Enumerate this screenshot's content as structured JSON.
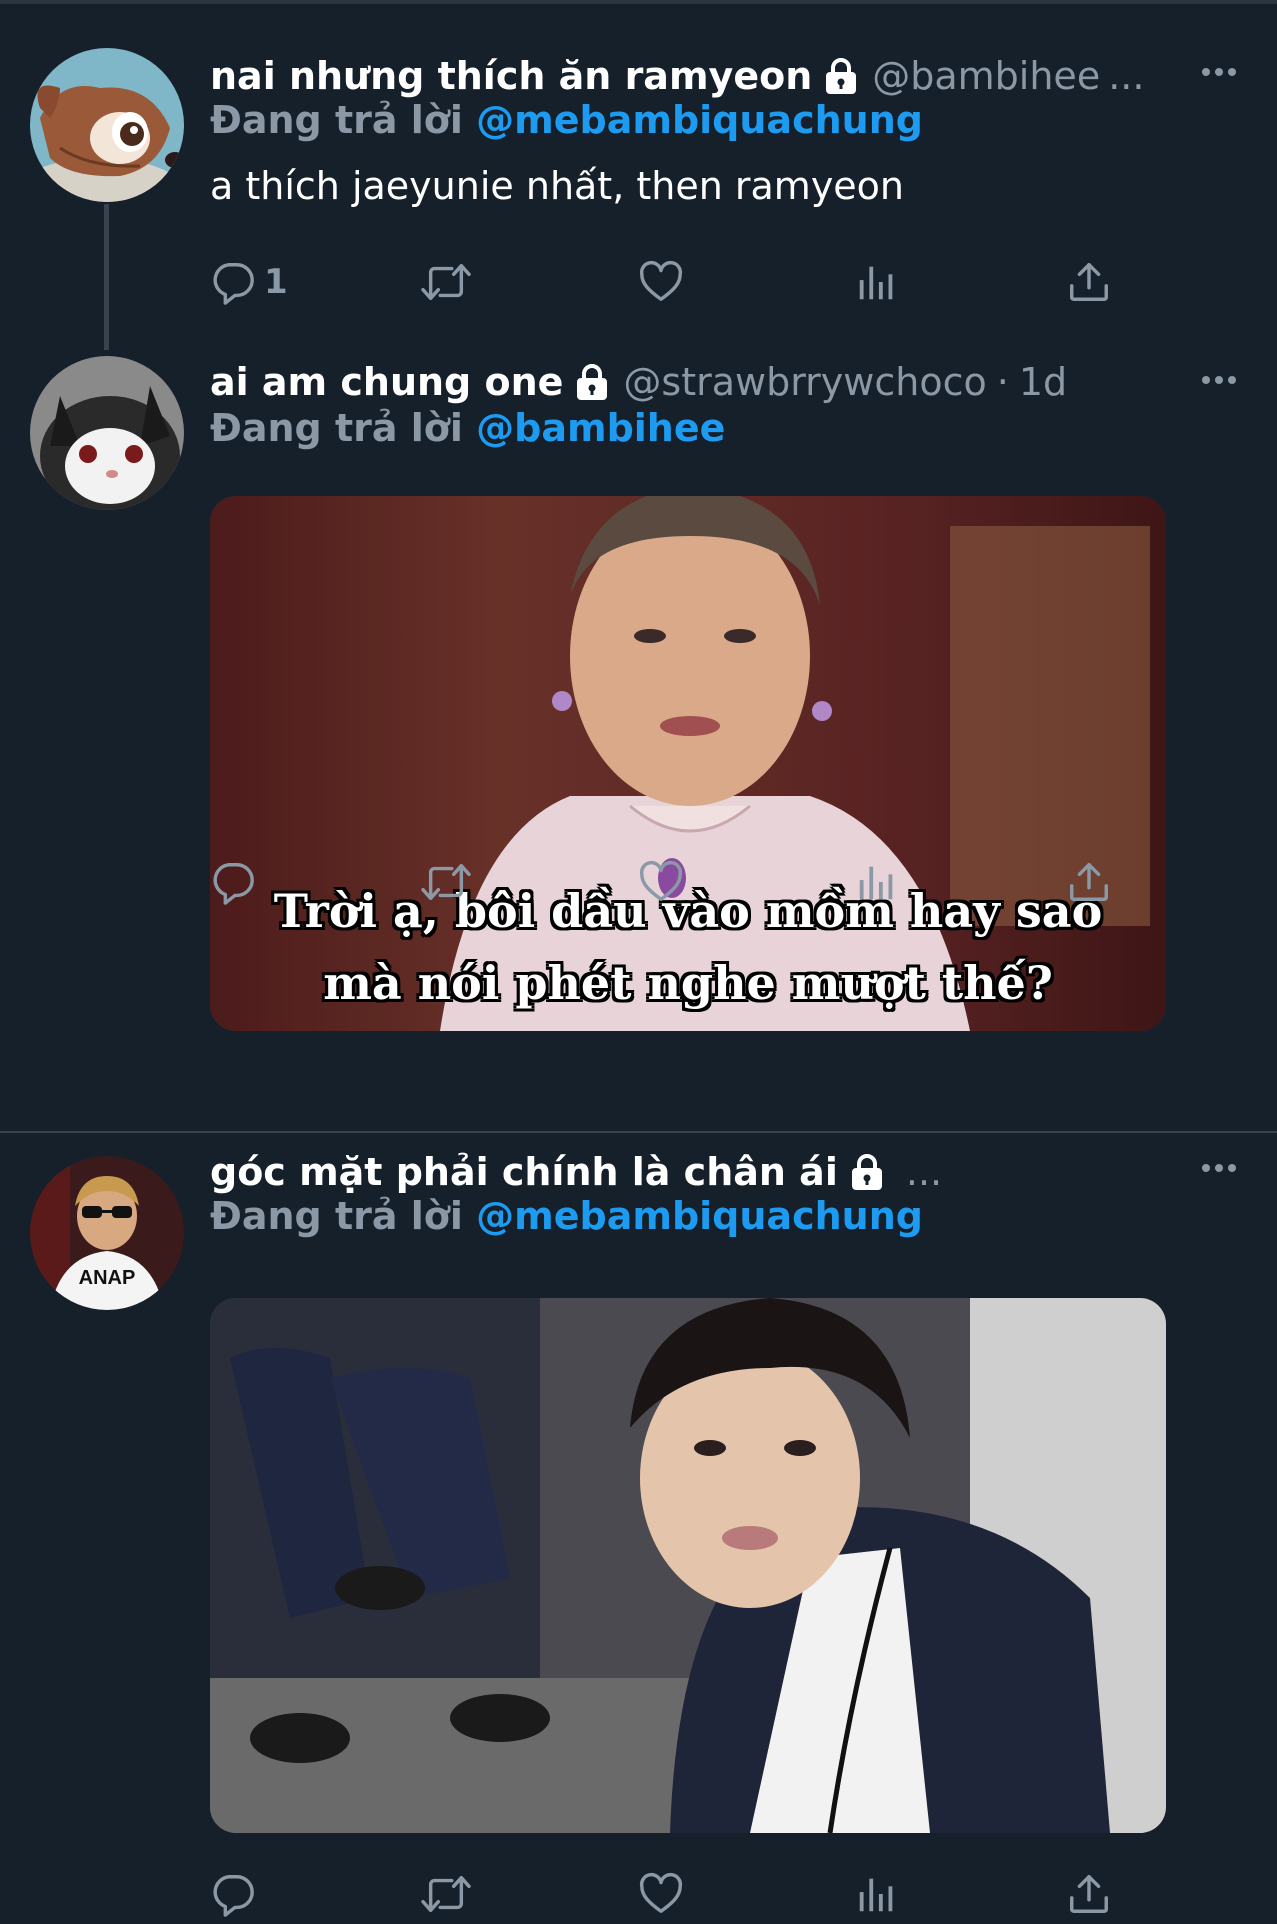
{
  "tweets": [
    {
      "display_name": "nai nhưng thích ăn ramyeon",
      "handle": "@bambihee",
      "time": "",
      "truncated": "...",
      "reply_prefix": "Đang trả lời",
      "reply_to": "@mebambiquachung",
      "text": "a thích jaeyunie nhất, then ramyeon",
      "reply_count": "1",
      "avatar_icon": "deer-avatar"
    },
    {
      "display_name": "ai am chung one",
      "handle": "@strawbrrywchoco",
      "separator": "·",
      "time": "1d",
      "reply_prefix": "Đang trả lời",
      "reply_to": "@bambihee",
      "media_caption_line1": "Trời ạ, bôi dầu vào mồm hay sao",
      "media_caption_line2": "mà nói phét nghe mượt thế?",
      "avatar_icon": "cat-avatar"
    },
    {
      "display_name": "góc mặt phải chính là chân ái",
      "handle": "",
      "truncated": "...",
      "reply_prefix": "Đang trả lời",
      "reply_to": "@mebambiquachung",
      "avatar_text": "ANAP",
      "avatar_icon": "child-sunglasses-avatar"
    }
  ],
  "icons": {
    "lock": "lock-icon",
    "more": "more-icon",
    "reply": "reply-icon",
    "retweet": "retweet-icon",
    "like": "like-icon",
    "views": "views-icon",
    "share": "share-icon"
  },
  "colors": {
    "background": "#15202b",
    "divider": "#38444d",
    "accent": "#1d9bf0",
    "secondary_text": "#8b98a5"
  }
}
